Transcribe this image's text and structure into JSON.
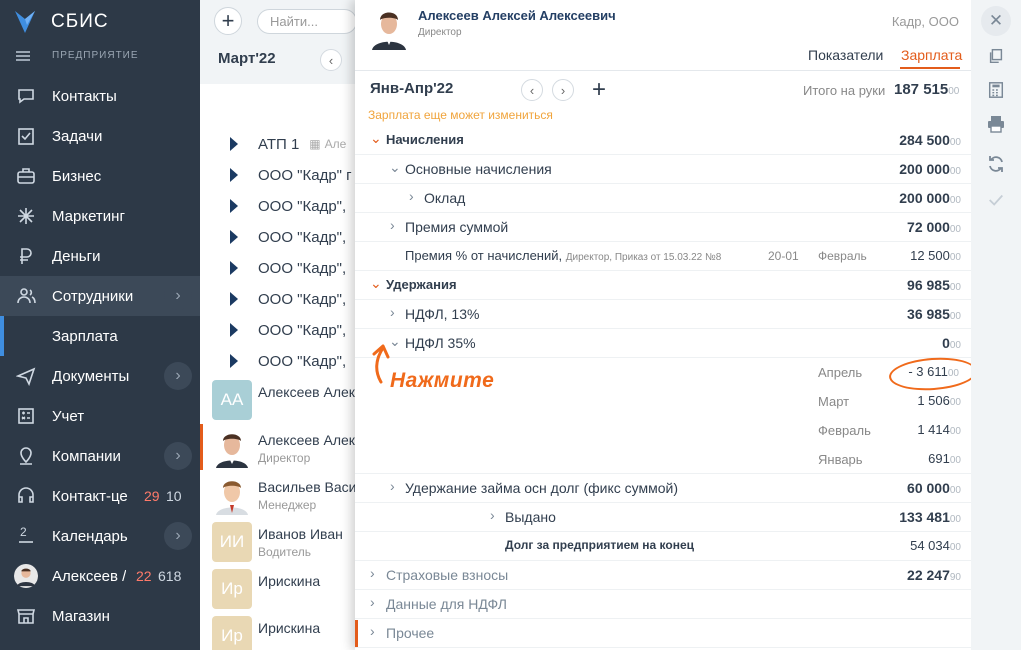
{
  "brand": {
    "name": "СБИС",
    "section": "ПРЕДПРИЯТИЕ"
  },
  "sidebar": {
    "items": [
      {
        "label": "Контакты",
        "icon": "chat-icon"
      },
      {
        "label": "Задачи",
        "icon": "tasks-icon"
      },
      {
        "label": "Бизнес",
        "icon": "business-icon"
      },
      {
        "label": "Маркетинг",
        "icon": "marketing-icon"
      },
      {
        "label": "Деньги",
        "icon": "money-icon"
      },
      {
        "label": "Сотрудники",
        "icon": "employees-icon"
      },
      {
        "label": "Зарплата",
        "icon": ""
      },
      {
        "label": "Документы",
        "icon": "documents-icon"
      },
      {
        "label": "Учет",
        "icon": "accounting-icon"
      },
      {
        "label": "Компании",
        "icon": "companies-icon"
      },
      {
        "label": "Контакт-це",
        "icon": "headset-icon",
        "count_red": "29",
        "count": "10"
      },
      {
        "label": "Календарь",
        "icon": "calendar-icon",
        "day": "2"
      },
      {
        "label": "Алексеев /",
        "icon": "avatar",
        "count_red": "22",
        "count": "618"
      },
      {
        "label": "Магазин",
        "icon": "store-icon"
      }
    ]
  },
  "list": {
    "search_placeholder": "Найти...",
    "month": "Март'22",
    "orgs": [
      "АТП 1",
      "ООО \"Кадр\" г",
      "ООО \"Кадр\",",
      "ООО \"Кадр\",",
      "ООО \"Кадр\",",
      "ООО \"Кадр\",",
      "ООО \"Кадр\",",
      "ООО \"Кадр\","
    ],
    "org_suffix": "Але",
    "people": [
      {
        "initials": "АА",
        "name": "Алексеев Алек",
        "role": "",
        "color": "#a9cfd6"
      },
      {
        "initials": "",
        "name": "Алексеев Алек",
        "role": "Директор",
        "color": "#ddd"
      },
      {
        "initials": "",
        "name": "Васильев Васи",
        "role": "Менеджер",
        "color": "#ddd"
      },
      {
        "initials": "ИИ",
        "name": "Иванов Иван",
        "role": "Водитель",
        "color": "#e9d8b4"
      },
      {
        "initials": "Ир",
        "name": "Ирискина",
        "role": "",
        "color": "#e9d8b4"
      },
      {
        "initials": "Ир",
        "name": "Ирискина",
        "role": "",
        "color": "#e9d8b4"
      }
    ]
  },
  "panel": {
    "employee": "Алексеев Алексей Алексеевич",
    "role": "Директор",
    "company": "Кадр, ООО",
    "tabs": [
      "Показатели",
      "Зарплата"
    ],
    "period": "Янв-Апр'22",
    "warning": "Зарплата еще может измениться",
    "total_label": "Итого на руки",
    "total_value": "187 515",
    "total_kop": "00",
    "rows": [
      {
        "text": "Начисления",
        "amount": "284 500",
        "kop": "00"
      },
      {
        "text": "Основные начисления",
        "amount": "200 000",
        "kop": "00"
      },
      {
        "text": "Оклад",
        "amount": "200 000",
        "kop": "00"
      },
      {
        "text": "Премия суммой",
        "amount": "72 000",
        "kop": "00"
      },
      {
        "text": "Премия % от начислений,",
        "note": "Директор, Приказ от 15.03.22 №8",
        "code": "20-01",
        "month": "Февраль",
        "amount": "12 500",
        "kop": "00"
      },
      {
        "text": "Удержания",
        "amount": "96 985",
        "kop": "00"
      },
      {
        "text": "НДФЛ, 13%",
        "amount": "36 985",
        "kop": "00"
      },
      {
        "text": "НДФЛ 35%",
        "amount": "0",
        "kop": "00"
      },
      {
        "month": "Апрель",
        "amount": "- 3 611",
        "kop": "00"
      },
      {
        "month": "Март",
        "amount": "1 506",
        "kop": "00"
      },
      {
        "month": "Февраль",
        "amount": "1 414",
        "kop": "00"
      },
      {
        "month": "Январь",
        "amount": "691",
        "kop": "00"
      },
      {
        "text": "Удержание займа осн долг (фикс суммой)",
        "amount": "60 000",
        "kop": "00"
      },
      {
        "text": "Выдано",
        "amount": "133 481",
        "kop": "00"
      },
      {
        "text": "Долг за предприятием на конец",
        "amount": "54 034",
        "kop": "00"
      },
      {
        "text": "Страховые взносы",
        "amount": "22 247",
        "kop": "90"
      },
      {
        "text": "Данные для НДФЛ"
      },
      {
        "text": "Прочее"
      }
    ],
    "hint": "Нажмите"
  },
  "colors": {
    "sidebar": "#2d3947",
    "accent": "#e35c1b",
    "warning": "#f0a43c",
    "hint": "#f06a1b"
  }
}
